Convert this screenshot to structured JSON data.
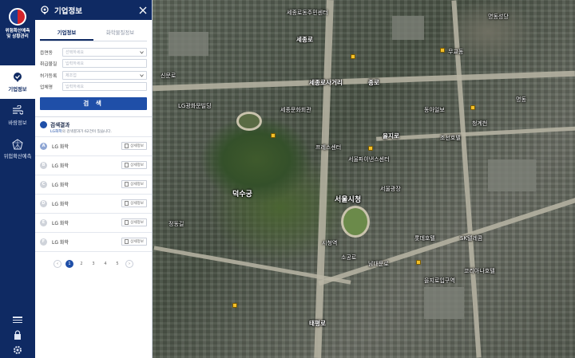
{
  "rail": {
    "logo_line1": "위험확산예측",
    "logo_line2": "및 상황관리",
    "nav": [
      {
        "label": "기업정보",
        "icon": "location-pin-icon",
        "active": true
      },
      {
        "label": "바람정보",
        "icon": "wind-icon",
        "active": false
      },
      {
        "label": "위험확산예측",
        "icon": "spread-star-icon",
        "active": false
      }
    ],
    "bottom_icons": [
      "layers-icon",
      "lock-icon",
      "gear-icon"
    ]
  },
  "panel": {
    "title": "기업정보",
    "tabs": [
      {
        "label": "기업정보",
        "active": true
      },
      {
        "label": "화학물질정보",
        "active": false
      }
    ],
    "form": {
      "fields": [
        {
          "label": "읍면동",
          "placeholder": "선택하세요",
          "type": "select"
        },
        {
          "label": "취급물질",
          "placeholder": "입력하세요",
          "type": "text"
        },
        {
          "label": "허가등록",
          "placeholder": "제조업",
          "type": "select"
        },
        {
          "label": "업체명",
          "placeholder": "입력하세요",
          "type": "text"
        }
      ],
      "search_label": "검 색"
    },
    "results": {
      "heading": "검색결과",
      "summary_pre": "LG화학",
      "summary_post": "의 검색결과가 62건이 있습니다.",
      "items": [
        {
          "badge": "A",
          "name": "LG 화학",
          "detail": "상세정보"
        },
        {
          "badge": "B",
          "name": "LG 화학",
          "detail": "상세정보"
        },
        {
          "badge": "C",
          "name": "LG 화학",
          "detail": "상세정보"
        },
        {
          "badge": "D",
          "name": "LG 화학",
          "detail": "상세정보"
        },
        {
          "badge": "E",
          "name": "LG 화학",
          "detail": "상세정보"
        },
        {
          "badge": "F",
          "name": "LG 화학",
          "detail": "상세정보"
        }
      ],
      "pages": [
        "1",
        "2",
        "3",
        "4",
        "5"
      ],
      "current_page": "1",
      "prev": "‹",
      "next": "›"
    }
  },
  "map": {
    "labels": [
      {
        "text": "세종로",
        "cls": "road-lbl"
      },
      {
        "text": "세종로사거리",
        "cls": "road-lbl"
      },
      {
        "text": "종로",
        "cls": "road-lbl"
      },
      {
        "text": "세종로동주민센터",
        "cls": ""
      },
      {
        "text": "세종문화회관",
        "cls": ""
      },
      {
        "text": "덕수궁",
        "cls": "big"
      },
      {
        "text": "서울시청",
        "cls": "big"
      },
      {
        "text": "롯데호텔",
        "cls": ""
      },
      {
        "text": "을지로입구역",
        "cls": ""
      },
      {
        "text": "명동성당",
        "cls": ""
      },
      {
        "text": "LG광화문빌딩",
        "cls": ""
      },
      {
        "text": "을지로",
        "cls": "road-lbl"
      },
      {
        "text": "소공로",
        "cls": ""
      },
      {
        "text": "동아일보",
        "cls": ""
      },
      {
        "text": "서울파이낸스센터",
        "cls": ""
      },
      {
        "text": "프레스센터",
        "cls": ""
      },
      {
        "text": "무교동",
        "cls": ""
      },
      {
        "text": "청계천",
        "cls": ""
      },
      {
        "text": "남대문로",
        "cls": ""
      },
      {
        "text": "시청역",
        "cls": ""
      },
      {
        "text": "서울광장",
        "cls": ""
      },
      {
        "text": "조선호텔",
        "cls": ""
      },
      {
        "text": "SK텔레콤",
        "cls": ""
      },
      {
        "text": "코리아나호텔",
        "cls": ""
      },
      {
        "text": "태평로",
        "cls": "road-lbl"
      },
      {
        "text": "정동길",
        "cls": ""
      },
      {
        "text": "신문로",
        "cls": ""
      },
      {
        "text": "명동",
        "cls": ""
      }
    ]
  }
}
